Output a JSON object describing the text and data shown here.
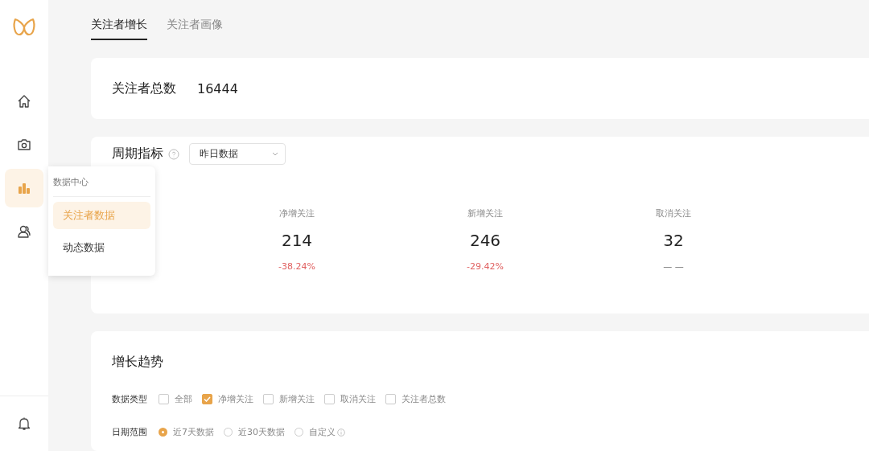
{
  "sidebar": {
    "items": [
      {
        "selected": false
      },
      {
        "selected": false
      },
      {
        "selected": true
      },
      {
        "selected": false
      }
    ]
  },
  "popup_menu": {
    "title": "数据中心",
    "items": [
      {
        "label": "关注者数据",
        "selected": true
      },
      {
        "label": "动态数据",
        "selected": false
      }
    ]
  },
  "tabs": [
    {
      "label": "关注者增长",
      "selected": true
    },
    {
      "label": "关注者画像",
      "selected": false
    }
  ],
  "total": {
    "label": "关注者总数",
    "value": "16444"
  },
  "period": {
    "title": "周期指标",
    "dropdown": "昨日数据",
    "metrics": [
      {
        "label": "净增关注",
        "value": "214",
        "change": "-38.24%",
        "kind": "down"
      },
      {
        "label": "新增关注",
        "value": "246",
        "change": "-29.42%",
        "kind": "down"
      },
      {
        "label": "取消关注",
        "value": "32",
        "change": "— —",
        "kind": "none"
      }
    ]
  },
  "trend": {
    "title": "增长趋势",
    "data_type": {
      "label": "数据类型",
      "options": [
        {
          "label": "全部",
          "checked": false
        },
        {
          "label": "净增关注",
          "checked": true
        },
        {
          "label": "新增关注",
          "checked": false
        },
        {
          "label": "取消关注",
          "checked": false
        },
        {
          "label": "关注者总数",
          "checked": false
        }
      ]
    },
    "date_range": {
      "label": "日期范围",
      "options": [
        {
          "label": "近7天数据",
          "selected": true
        },
        {
          "label": "近30天数据",
          "selected": false
        },
        {
          "label": "自定义",
          "selected": false
        }
      ]
    }
  }
}
